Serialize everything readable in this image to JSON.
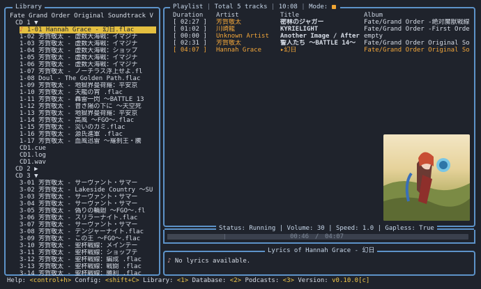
{
  "library": {
    "title": "Library",
    "header": "Fate Grand Order Original Soundtrack V ▼",
    "cd1": "CD 1 ▼",
    "cd2": "CD 2 ▶",
    "cd3": "CD 3 ▼",
    "selected": "1-01 Hannah Grace - 幻日.flac",
    "cd1_items": [
      "1-02 芳賀敬太 - 虚数大海戦：イマジナ",
      "1-03 芳賀敬太 - 虚数大海戦：イマジナ",
      "1-04 芳賀敬太 - 虚数大海戦：ショップ",
      "1-05 芳賀敬太 - 虚数大海戦：イマジナ",
      "1-06 芳賀敬太 - 虚数大海戦：イマジナ",
      "1-07 芳賀敬太 - ノーチラス浮上せよ.fl",
      "1-08 Doul - The Golden Path.flac",
      "1-09 芳賀敬太 - 地獄界曼荷羅：平安京",
      "1-10 芳賀敬太 - 天龍の宵 .flac",
      "1-11 芳賀敬太 - 轟雷一閃 〜BATTLE 13",
      "1-12 芳賀敬太 - 昔き陽の下に 〜天空死",
      "1-13 芳賀敬太 - 地獄界曼荷羅：平安京",
      "1-14 芳賀敬太 - 高風 〜FGO〜.flac",
      "1-15 芳賀敬太 - 災いのカミ.flac",
      "1-16 芳賀敬太 - 源氏進軍 .flac",
      "1-17 芳賀敬太 - 血風迅雷 〜羅刹王・騰"
    ],
    "files": [
      "CD1.cue",
      "CD1.log",
      "CD1.wav"
    ],
    "cd3_items": [
      "3-01 芳賀敬太 - サーヴァント・サマー",
      "3-02 芳賀敬太 - Lakeside Country 〜SU",
      "3-03 芳賀敬太 - サーヴァント・サマー",
      "3-04 芳賀敬太 - サーヴァント・サマー",
      "3-05 芳賀敬太 - 偽りの輪廻 〜FGO〜.fl",
      "3-06 芳賀敬太 - スリラーナイト.flac",
      "3-07 芳賀敬太 - サーヴァント・サマー",
      "3-08 芳賀敬太 - デンジャーナイト.flac",
      "3-09 芳賀敬太 - この王 〜FGO〜.flac",
      "3-10 芳賀敬太 - 聖杯戦線：メインテー",
      "3-11 芳賀敬太 - 聖杯戦線：ショップテ",
      "3-12 芳賀敬太 - 聖杯戦線：編成 .flac",
      "3-13 芳賀敬太 - 聖杯戦線：戦闘 .flac",
      "3-14 芳賀敬太 - 聖杯戦線：勝利 .flac"
    ]
  },
  "playlist": {
    "title": "Playlist",
    "total": "Total 5 tracks",
    "time": "10:08",
    "mode": "Mode:",
    "headers": [
      "Duration",
      "Artist",
      "Title",
      "Album"
    ],
    "rows": [
      [
        "[ 02:27 ]",
        "芳賀敬太",
        "密林のジャガー",
        "Fate/Grand Order -絶対魔獣戦線バ"
      ],
      [
        "[ 01:02 ]",
        "川崎龍",
        "KYRIELIGHT",
        "Fate/Grand Order -First Order- &"
      ],
      [
        "[ 00:00 ]",
        "Unknown Artist",
        "Another Image / After",
        "empty"
      ],
      [
        "[ 02:31 ]",
        "芳賀敬太",
        "誓人たち 〜BATTLE 14〜",
        "Fate/Grand Order Original Soundt"
      ],
      [
        "[ 04:07 ]",
        "Hannah Grace",
        "▸幻日",
        "Fate/Grand Order Original Soundt"
      ]
    ]
  },
  "status": {
    "text": "Status: Running | Volume: 30 | Speed: 1.0 | Gapless: True",
    "elapsed": "00:46",
    "total": "04:07",
    "progress": 0.19
  },
  "lyrics": {
    "title": "Lyrics of Hannah Grace - 幻日",
    "text": "No lyrics available."
  },
  "footer": {
    "help_label": "Help:",
    "help_key": "<control+h>",
    "config_label": "Config:",
    "config_key": "<shift+C>",
    "library_label": "Library:",
    "library_key": "<1>",
    "database_label": "Database:",
    "database_key": "<2>",
    "podcasts_label": "Podcasts:",
    "podcasts_key": "<3>",
    "version_label": "Version:",
    "version_value": "v0.10.0[c]"
  },
  "colors": {
    "border": "#5d93c9",
    "accent": "#f2c94c",
    "orange": "#f2a63a",
    "background": "#1f232c"
  }
}
